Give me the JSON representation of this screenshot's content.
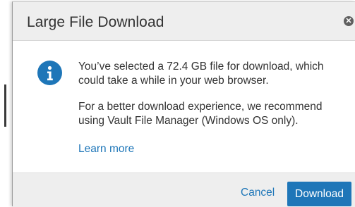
{
  "dialog": {
    "title": "Large File Download",
    "close_icon": "close-circle-icon",
    "info_icon": "info-icon",
    "message_line1": "You’ve selected a 72.4 GB file for download, which could take a while in your web browser.",
    "message_line2": "For a better download experience, we recommend using Vault File Manager (Windows OS only).",
    "learn_more": "Learn more",
    "cancel_label": "Cancel",
    "download_label": "Download"
  },
  "colors": {
    "accent": "#1e76b8",
    "header_bg": "#eeeeee",
    "footer_bg": "#eeeeee",
    "text": "#333333"
  }
}
